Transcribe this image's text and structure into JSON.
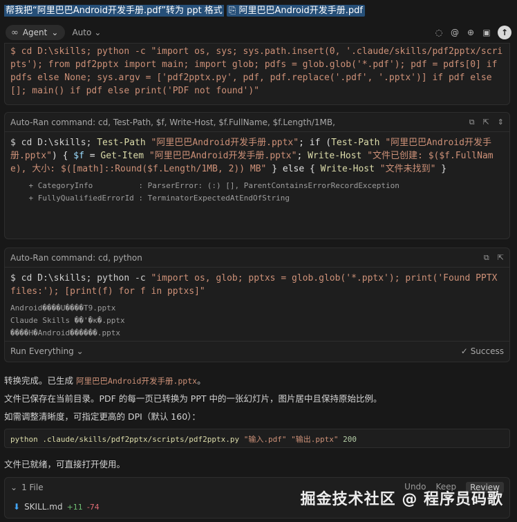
{
  "prompt": {
    "text": "帮我把“阿里巴巴Android开发手册.pdf”转为 ppt 格式",
    "mention": "阿里巴巴Android开发手册.pdf"
  },
  "agentbar": {
    "mode": "Agent",
    "model": "Auto"
  },
  "cmd1": {
    "code": "$ cd D:\\skills; python -c \"import os, sys; sys.path.insert(0, '.claude/skills/pdf2pptx/scripts'); from pdf2pptx import main; import glob; pdfs = glob.glob('*.pdf'); pdf = pdfs[0] if pdfs else None; sys.argv = ['pdf2pptx.py', pdf, pdf.replace('.pdf', '.pptx')] if pdf else []; main() if pdf else print('PDF not found')\""
  },
  "cmd2": {
    "header": "Auto-Ran command: cd, Test-Path, $f, Write-Host, $f.FullName, $f.Length/1MB,",
    "prefix": "$ cd D:\\skills; ",
    "c1": "Test-Path",
    "s1": " \"阿里巴巴Android开发手册.pptx\"",
    "c2": "; if (",
    "c3": "Test-Path",
    "s2": " \"阿里巴巴Android开发手册.pptx\"",
    "c4": ") { ",
    "v1": "$f",
    "c5": " = ",
    "c6": "Get-Item",
    "s3": " \"阿里巴巴Android开发手册.pptx\"",
    "c7": "; ",
    "c8": "Write-Host",
    "s4": " \"文件已创建: $($f.FullName), 大小: $([math]::Round($f.Length/1MB, 2)) MB\"",
    "c9": " } else { ",
    "c10": "Write-Host",
    "s5": " \"文件未找到\"",
    "c11": " }",
    "out1": "    + CategoryInfo          : ParserError: (:) [], ParentContainsErrorRecordException",
    "out2": "    + FullyQualifiedErrorId : TerminatorExpectedAtEndOfString"
  },
  "cmd3": {
    "header": "Auto-Ran command: cd, python",
    "prefix": "$ cd D:\\skills; python -c ",
    "str": "\"import os, glob; pptxs = glob.glob('*.pptx'); print('Found PPTX files:'); [print(f) for f in pptxs]\"",
    "out1": "Android����U����T9.pptx",
    "out2": "Claude Skills ��'�к�.pptx",
    "out3": "����H�Android������.pptx",
    "footer": "Run Everything",
    "status": "Success"
  },
  "result": {
    "line1_prefix": "转换完成。已生成 ",
    "line1_file": "阿里巴巴Android开发手册.pptx",
    "line1_suffix": "。",
    "line2": "文件已保存在当前目录。PDF 的每一页已转换为 PPT 中的一张幻灯片，图片居中且保持原始比例。",
    "line3": "如需调整清晰度，可指定更高的 DPI（默认 160）：",
    "code_fn": "python .claude/skills/pdf2pptx/scripts/pdf2pptx.py ",
    "code_s1": "\"输入.pdf\"",
    "code_s2": " \"输出.pptx\"",
    "code_num": " 200",
    "line4": "文件已就绪，可直接打开使用。"
  },
  "files": {
    "count": "1 File",
    "undo": "Undo",
    "keep": "Keep",
    "review": "Review",
    "name": "SKILL.md",
    "added": "+11",
    "removed": "-74"
  },
  "watermark": "掘金技术社区 @ 程序员码歌"
}
